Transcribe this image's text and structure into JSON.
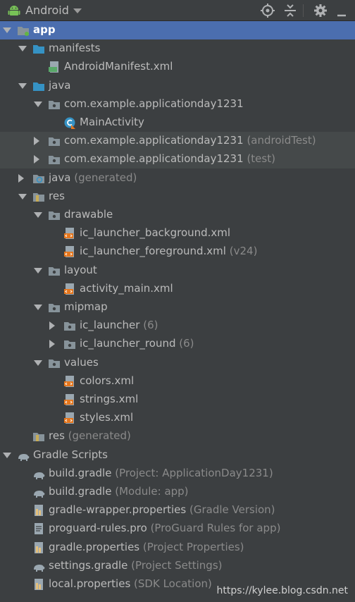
{
  "toolbar": {
    "title": "Android",
    "icons": [
      "locate-icon",
      "collapse-icon",
      "gear-icon",
      "hide-icon"
    ]
  },
  "tree": [
    {
      "label": "app",
      "hint": "",
      "icon": "module-folder",
      "arrow": "down",
      "depth": 0,
      "selected": true
    },
    {
      "label": "manifests",
      "hint": "",
      "icon": "folder-blue",
      "arrow": "down",
      "depth": 1
    },
    {
      "label": "AndroidManifest.xml",
      "hint": "",
      "icon": "manifest-file",
      "arrow": "",
      "depth": 2
    },
    {
      "label": "java",
      "hint": "",
      "icon": "folder-blue",
      "arrow": "down",
      "depth": 1
    },
    {
      "label": "com.example.applicationday1231",
      "hint": "",
      "icon": "package",
      "arrow": "down",
      "depth": 2
    },
    {
      "label": "MainActivity",
      "hint": "",
      "icon": "class",
      "arrow": "",
      "depth": 3
    },
    {
      "label": "com.example.applicationday1231",
      "hint": "(androidTest)",
      "icon": "package",
      "arrow": "right",
      "depth": 2,
      "highlight": true
    },
    {
      "label": "com.example.applicationday1231",
      "hint": "(test)",
      "icon": "package",
      "arrow": "right",
      "depth": 2,
      "highlight": true
    },
    {
      "label": "java",
      "hint": "(generated)",
      "icon": "gen-folder",
      "arrow": "right",
      "depth": 1
    },
    {
      "label": "res",
      "hint": "",
      "icon": "res-folder",
      "arrow": "down",
      "depth": 1
    },
    {
      "label": "drawable",
      "hint": "",
      "icon": "package",
      "arrow": "down",
      "depth": 2
    },
    {
      "label": "ic_launcher_background.xml",
      "hint": "",
      "icon": "xml-file",
      "arrow": "",
      "depth": 3
    },
    {
      "label": "ic_launcher_foreground.xml",
      "hint": "(v24)",
      "icon": "xml-file",
      "arrow": "",
      "depth": 3
    },
    {
      "label": "layout",
      "hint": "",
      "icon": "package",
      "arrow": "down",
      "depth": 2
    },
    {
      "label": "activity_main.xml",
      "hint": "",
      "icon": "xml-file",
      "arrow": "",
      "depth": 3
    },
    {
      "label": "mipmap",
      "hint": "",
      "icon": "package",
      "arrow": "down",
      "depth": 2
    },
    {
      "label": "ic_launcher",
      "hint": "(6)",
      "icon": "package",
      "arrow": "right",
      "depth": 3
    },
    {
      "label": "ic_launcher_round",
      "hint": "(6)",
      "icon": "package",
      "arrow": "right",
      "depth": 3
    },
    {
      "label": "values",
      "hint": "",
      "icon": "package",
      "arrow": "down",
      "depth": 2
    },
    {
      "label": "colors.xml",
      "hint": "",
      "icon": "xml-file",
      "arrow": "",
      "depth": 3
    },
    {
      "label": "strings.xml",
      "hint": "",
      "icon": "xml-file",
      "arrow": "",
      "depth": 3
    },
    {
      "label": "styles.xml",
      "hint": "",
      "icon": "xml-file",
      "arrow": "",
      "depth": 3
    },
    {
      "label": "res",
      "hint": "(generated)",
      "icon": "res-folder",
      "arrow": "",
      "depth": 1
    },
    {
      "label": "Gradle Scripts",
      "hint": "",
      "icon": "gradle",
      "arrow": "down",
      "depth": 0
    },
    {
      "label": "build.gradle",
      "hint": "(Project: ApplicationDay1231)",
      "icon": "gradle",
      "arrow": "",
      "depth": 1
    },
    {
      "label": "build.gradle",
      "hint": "(Module: app)",
      "icon": "gradle",
      "arrow": "",
      "depth": 1
    },
    {
      "label": "gradle-wrapper.properties",
      "hint": "(Gradle Version)",
      "icon": "properties-file",
      "arrow": "",
      "depth": 1
    },
    {
      "label": "proguard-rules.pro",
      "hint": "(ProGuard Rules for app)",
      "icon": "text-file",
      "arrow": "",
      "depth": 1
    },
    {
      "label": "gradle.properties",
      "hint": "(Project Properties)",
      "icon": "properties-file",
      "arrow": "",
      "depth": 1
    },
    {
      "label": "settings.gradle",
      "hint": "(Project Settings)",
      "icon": "gradle",
      "arrow": "",
      "depth": 1
    },
    {
      "label": "local.properties",
      "hint": "(SDK Location)",
      "icon": "properties-file",
      "arrow": "",
      "depth": 1
    }
  ],
  "watermark": "https://kylee.blog.csdn.net",
  "colors": {
    "selected": "#4b6eaf",
    "highlight": "#45494a",
    "background": "#3c3f41",
    "folder": "#3592c4",
    "xml": "#e5761c"
  }
}
